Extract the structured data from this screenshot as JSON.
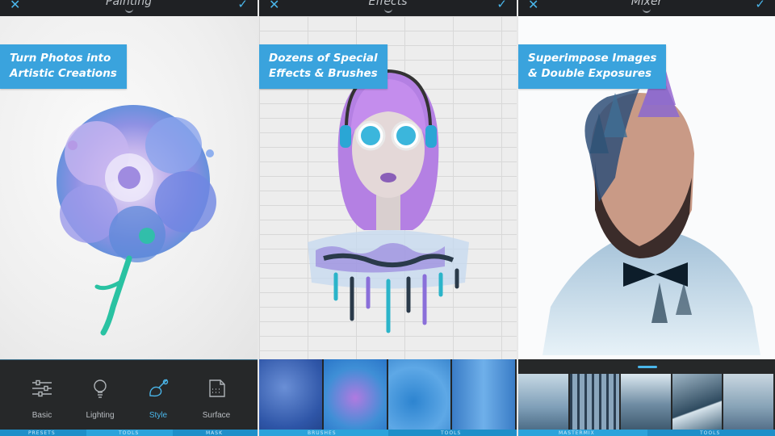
{
  "panels": [
    {
      "title": "Painting",
      "caption": [
        "Turn Photos into",
        "Artistic Creations"
      ],
      "tools": [
        {
          "label": "Basic",
          "icon": "sliders-icon"
        },
        {
          "label": "Lighting",
          "icon": "bulb-icon"
        },
        {
          "label": "Style",
          "icon": "brush-icon"
        },
        {
          "label": "Surface",
          "icon": "canvas-icon"
        }
      ],
      "active_tool": "Style",
      "bottom_tabs": [
        "PRESETS",
        "TOOLS",
        "MASK"
      ]
    },
    {
      "title": "Effects",
      "caption": [
        "Dozens of Special",
        "Effects & Brushes"
      ],
      "bottom_tabs": [
        "BRUSHES",
        "TOOLS"
      ]
    },
    {
      "title": "Mixer",
      "caption": [
        "Superimpose Images",
        "& Double Exposures"
      ],
      "bottom_tabs": [
        "MASTERMIX",
        "TOOLS"
      ]
    }
  ],
  "colors": {
    "accent": "#4ab6ea",
    "caption_bg": "#3aa3dd",
    "toolbar_bg": "#262829",
    "topbar_bg": "#1f2124"
  },
  "icons": {
    "close": "close-icon",
    "confirm": "checkmark-icon"
  }
}
